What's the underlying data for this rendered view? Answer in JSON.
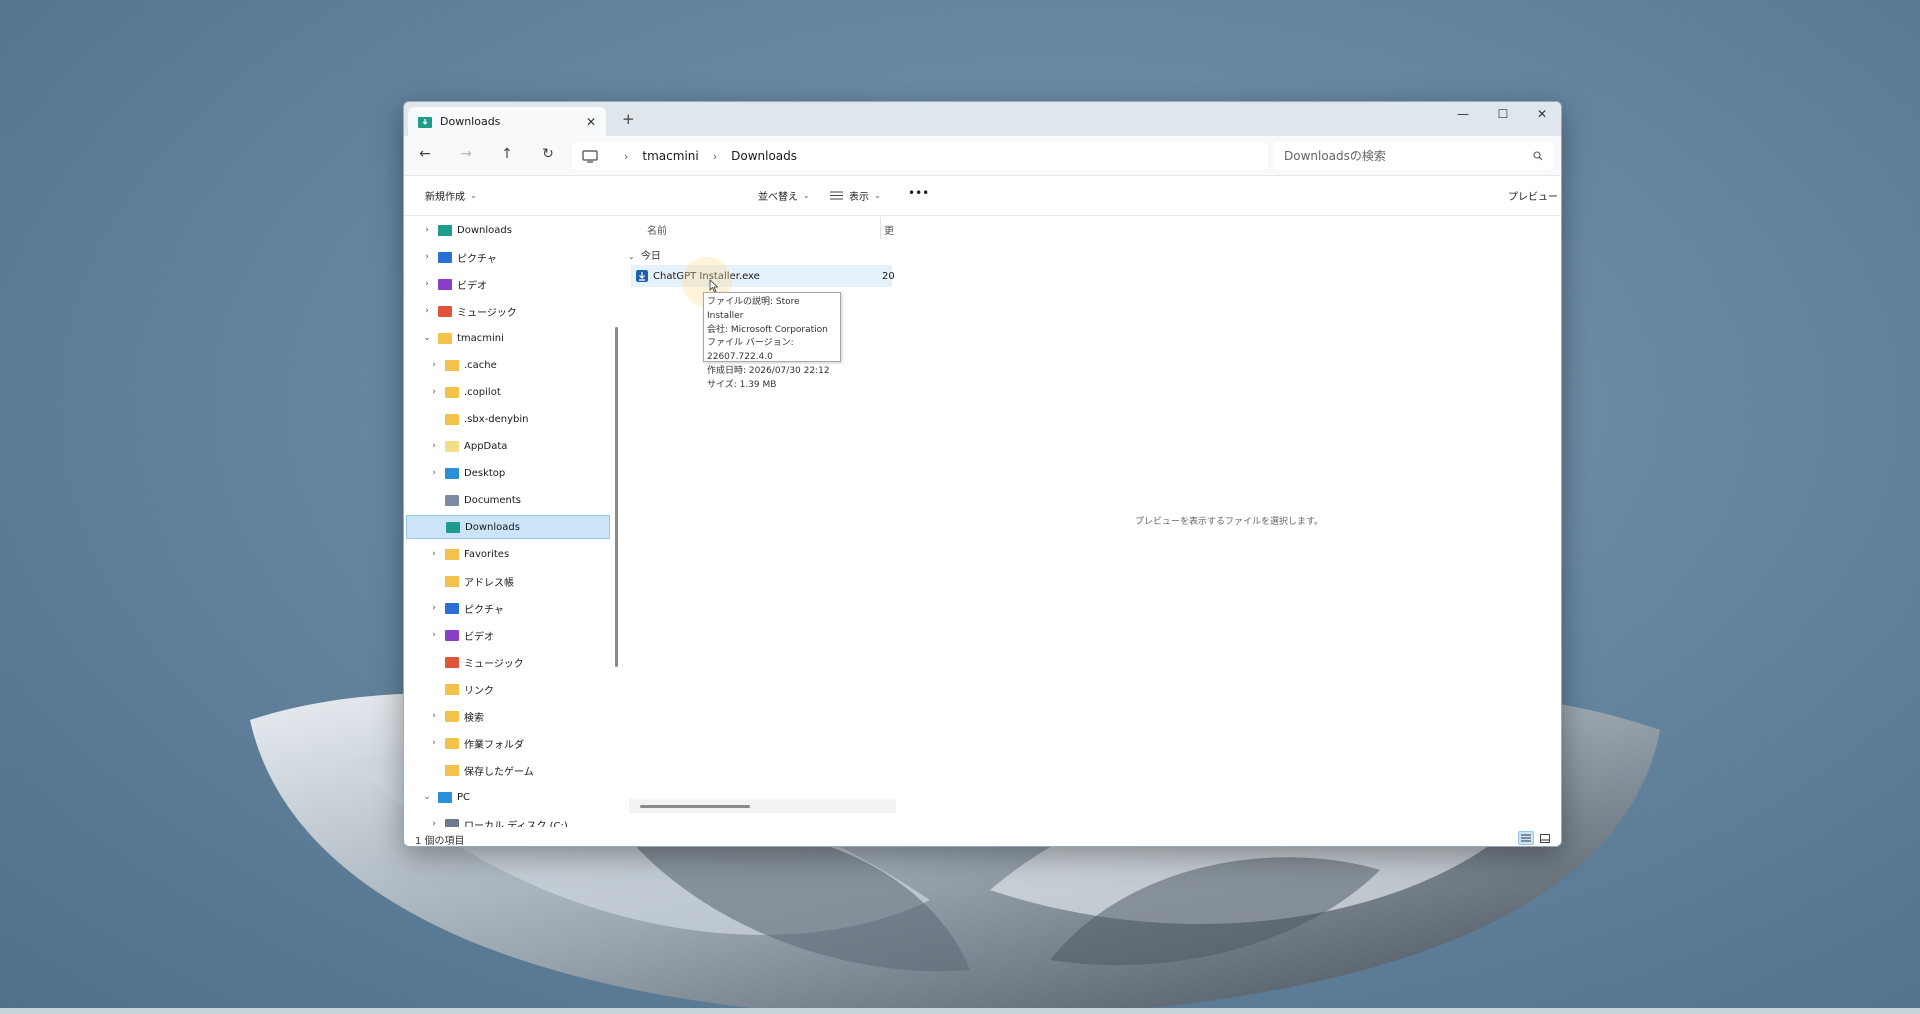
{
  "window": {
    "tab_title": "Downloads",
    "new_tab": "+",
    "minimize": "—",
    "maximize": "☐",
    "close": "✕"
  },
  "nav": {
    "back": "←",
    "forward": "→",
    "up": "↑",
    "refresh": "↻",
    "breadcrumb": [
      "tmacmini",
      "Downloads"
    ],
    "search_placeholder": "Downloadsの検索"
  },
  "toolbar": {
    "new": "新規作成",
    "sort": "並べ替え",
    "view": "表示",
    "more": "•••",
    "preview": "プレビュー"
  },
  "sidebar": {
    "items": [
      {
        "label": "Downloads",
        "expander": "›",
        "color": "#1e9c8c"
      },
      {
        "label": "ピクチャ",
        "expander": "›",
        "color": "#2a6fd6"
      },
      {
        "label": "ビデオ",
        "expander": "›",
        "color": "#8a3fc7"
      },
      {
        "label": "ミュージック",
        "expander": "›",
        "color": "#e0553a"
      },
      {
        "label": "tmacmini",
        "expander": "⌄",
        "color": "#f2c24a"
      },
      {
        "label": ".cache",
        "expander": "›",
        "color": "#f2c24a"
      },
      {
        "label": ".copilot",
        "expander": "›",
        "color": "#f2c24a"
      },
      {
        "label": ".sbx-denybin",
        "expander": "",
        "color": "#f2c24a"
      },
      {
        "label": "AppData",
        "expander": "›",
        "color": "#f5dc8a"
      },
      {
        "label": "Desktop",
        "expander": "›",
        "color": "#2a8fd6"
      },
      {
        "label": "Documents",
        "expander": "",
        "color": "#7a8aa0"
      },
      {
        "label": "Downloads",
        "expander": "",
        "color": "#1e9c8c"
      },
      {
        "label": "Favorites",
        "expander": "›",
        "color": "#f2c24a"
      },
      {
        "label": "アドレス帳",
        "expander": "",
        "color": "#f2c24a"
      },
      {
        "label": "ピクチャ",
        "expander": "›",
        "color": "#2a6fd6"
      },
      {
        "label": "ビデオ",
        "expander": "›",
        "color": "#8a3fc7"
      },
      {
        "label": "ミュージック",
        "expander": "",
        "color": "#e0553a"
      },
      {
        "label": "リンク",
        "expander": "",
        "color": "#f2c24a"
      },
      {
        "label": "検索",
        "expander": "›",
        "color": "#f2c24a"
      },
      {
        "label": "作業フォルダ",
        "expander": "›",
        "color": "#f2c24a"
      },
      {
        "label": "保存したゲーム",
        "expander": "",
        "color": "#f2c24a"
      },
      {
        "label": "PC",
        "expander": "⌄",
        "color": "#2a8fd6"
      },
      {
        "label": "ローカル ディスク (C:)",
        "expander": "›",
        "color": "#6b7b8c"
      }
    ]
  },
  "content": {
    "col_name": "名前",
    "col_date": "更",
    "group_label": "今日",
    "group_chevron": "⌄",
    "file_name": "ChatGPT Installer.exe",
    "file_date_clip": "20",
    "tooltip": [
      "ファイルの説明: Store Installer",
      "会社: Microsoft Corporation",
      "ファイル バージョン: 22607.722.4.0",
      "作成日時: 2026/07/30 22:12",
      "サイズ: 1.39 MB"
    ]
  },
  "preview": {
    "message": "プレビューを表示するファイルを選択します。"
  },
  "status": {
    "count": "1 個の項目"
  }
}
